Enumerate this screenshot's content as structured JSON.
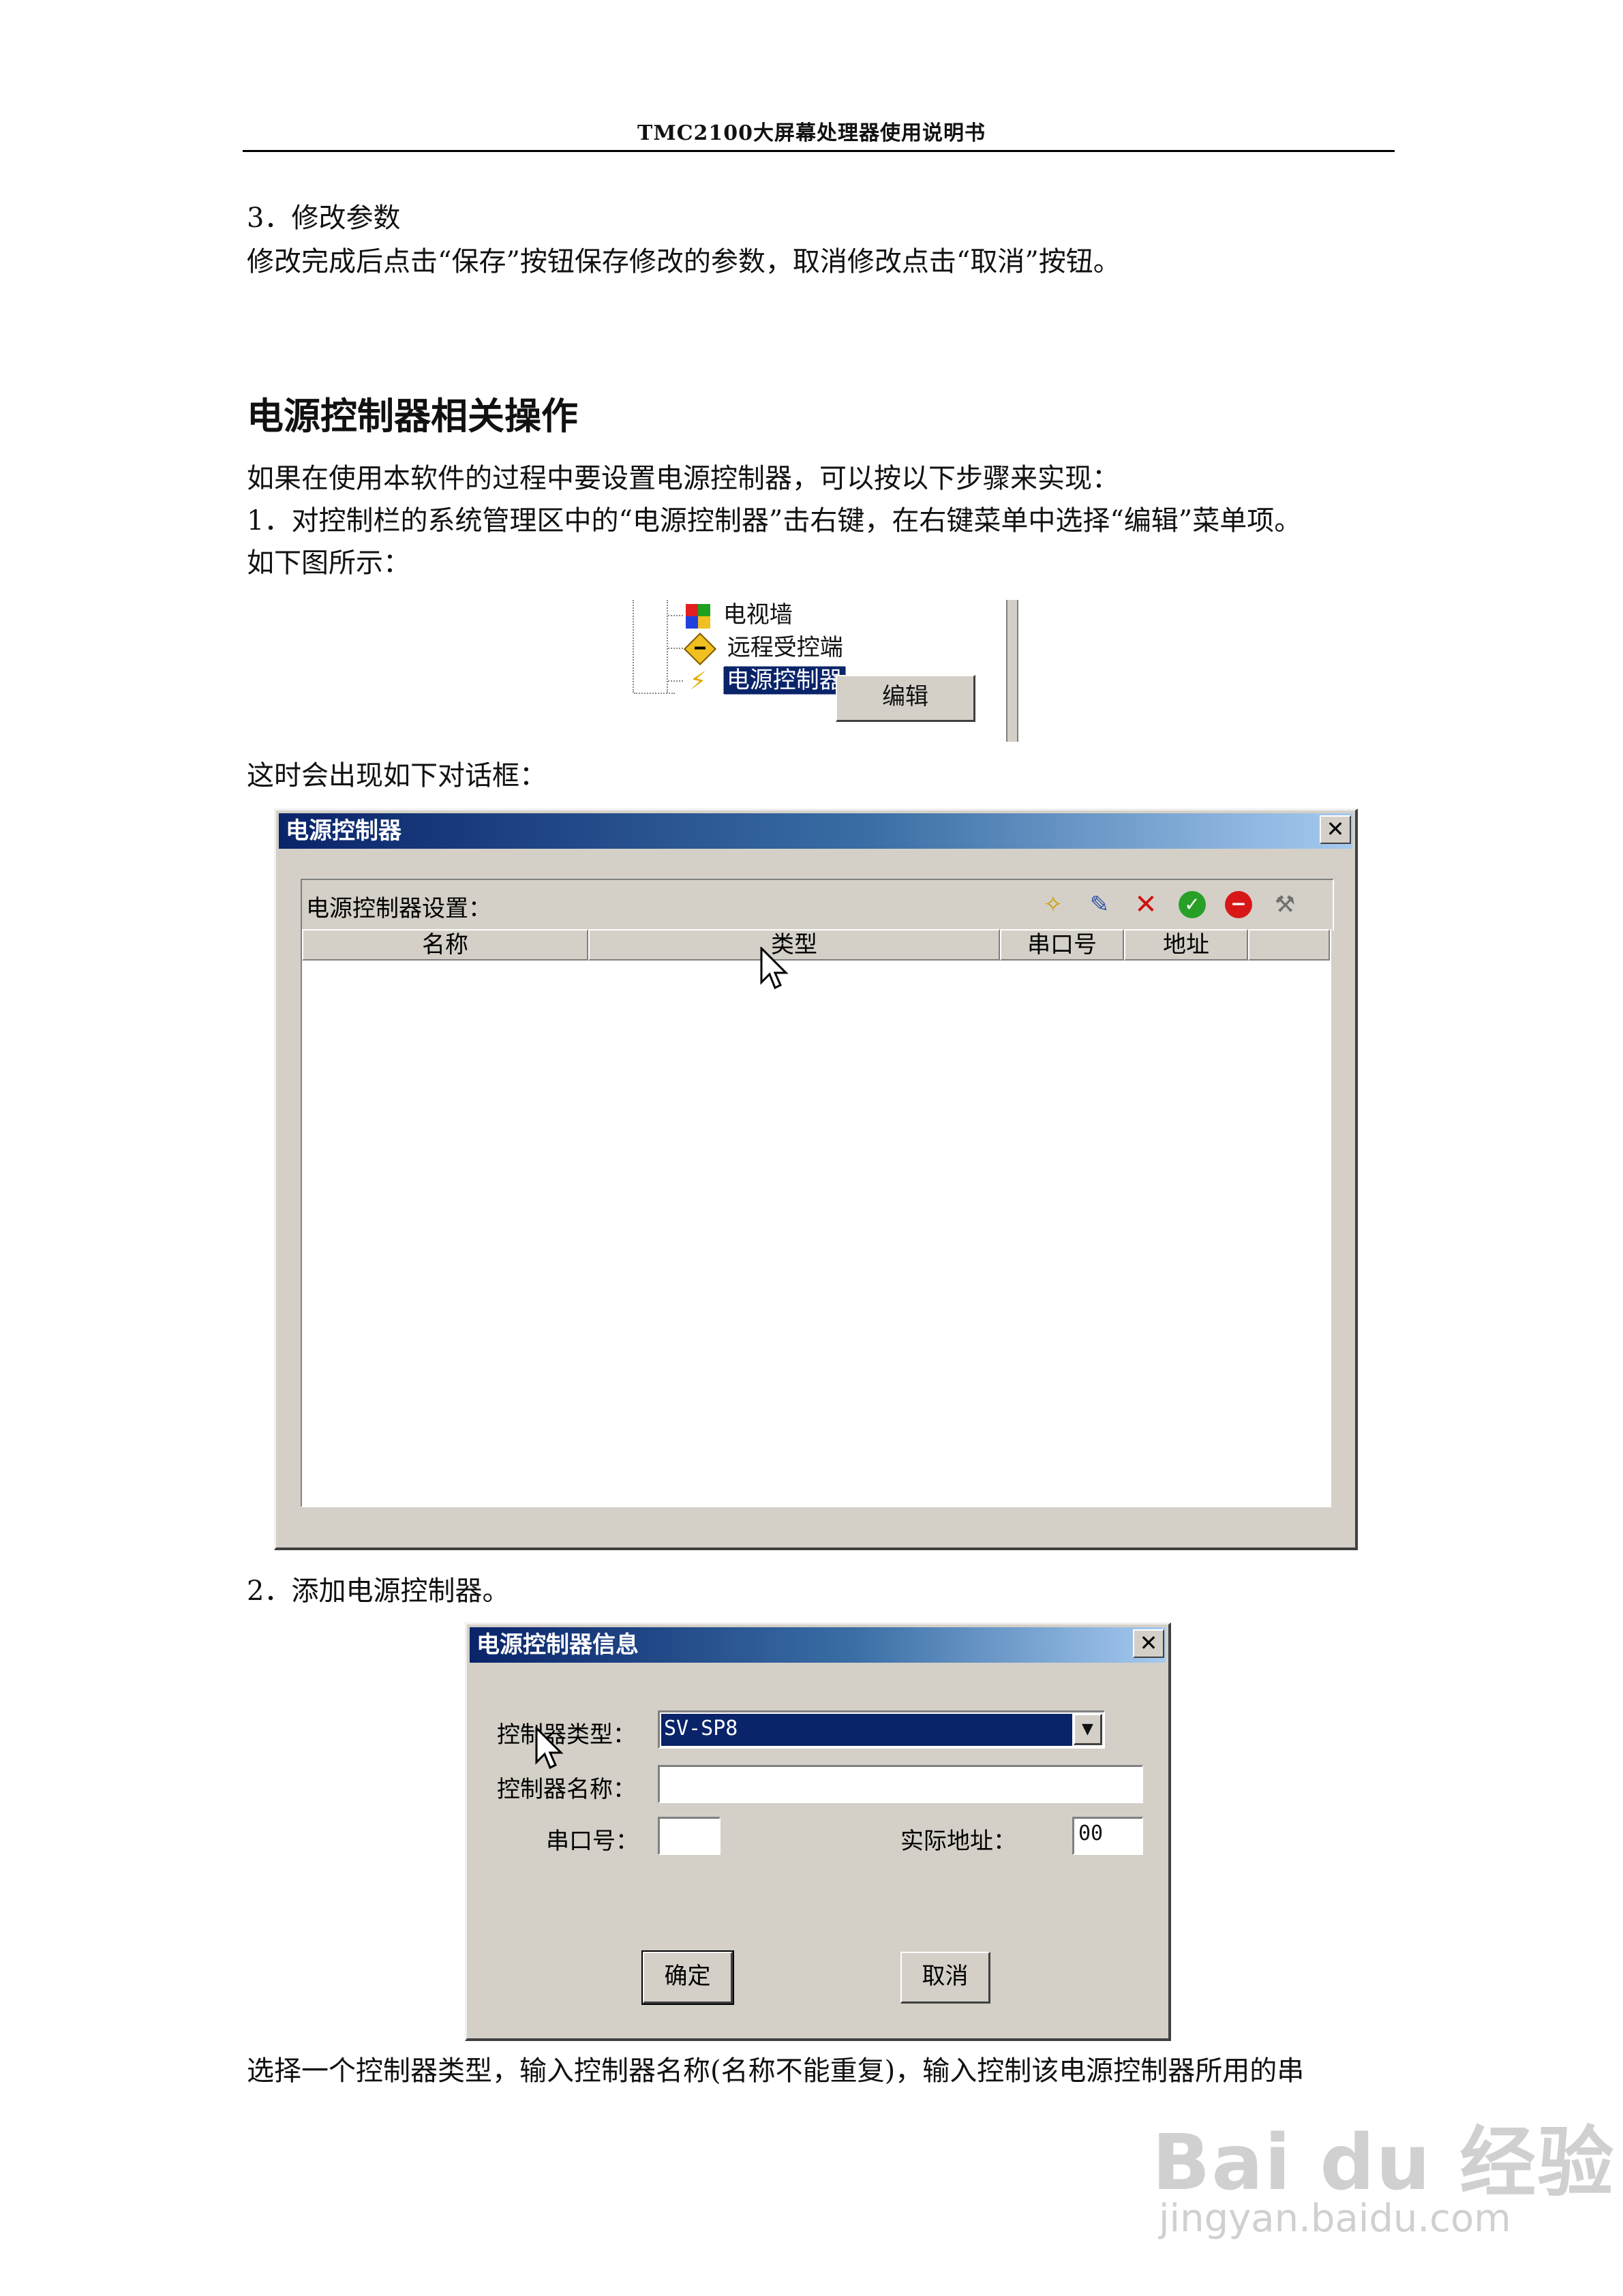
{
  "header": {
    "title": "TMC2100大屏幕处理器使用说明书"
  },
  "section3": {
    "heading": "3．修改参数",
    "text": "修改完成后点击“保存”按钮保存修改的参数，取消修改点击“取消”按钮。"
  },
  "power_section": {
    "title": "电源控制器相关操作",
    "intro": "如果在使用本软件的过程中要设置电源控制器，可以按以下步骤来实现：",
    "step1": "1．对控制栏的系统管理区中的“电源控制器”击右键，在右键菜单中选择“编辑”菜单项。",
    "step1_cont": "如下图所示：",
    "dialog_intro": "这时会出现如下对话框：",
    "step2": "2．添加电源控制器。",
    "footer_text": "选择一个控制器类型，输入控制器名称(名称不能重复)，输入控制该电源控制器所用的串"
  },
  "tree": {
    "items": [
      "电视墙",
      "远程受控端",
      "电源控制器"
    ],
    "icons": [
      "tv-wall-icon",
      "remote-client-icon",
      "lightning-icon"
    ],
    "context_menu": [
      "编辑"
    ]
  },
  "dialog1": {
    "title": "电源控制器",
    "close": "✕",
    "settings_label": "电源控制器设置：",
    "toolbar_icons": [
      "new-icon",
      "edit-icon",
      "delete-icon",
      "confirm-icon",
      "stop-icon",
      "tools-icon"
    ],
    "columns": [
      "名称",
      "类型",
      "串口号",
      "地址"
    ]
  },
  "dialog2": {
    "title": "电源控制器信息",
    "close": "✕",
    "type_label": "控制器类型：",
    "type_value": "SV-SP8",
    "name_label": "控制器名称：",
    "name_value": "",
    "port_label": "串口号：",
    "port_value": "",
    "address_label": "实际地址：",
    "address_value": "00",
    "ok": "确定",
    "cancel": "取消"
  },
  "watermark": {
    "brand": "Bai du 经验",
    "url": "jingyan.baidu.com"
  }
}
